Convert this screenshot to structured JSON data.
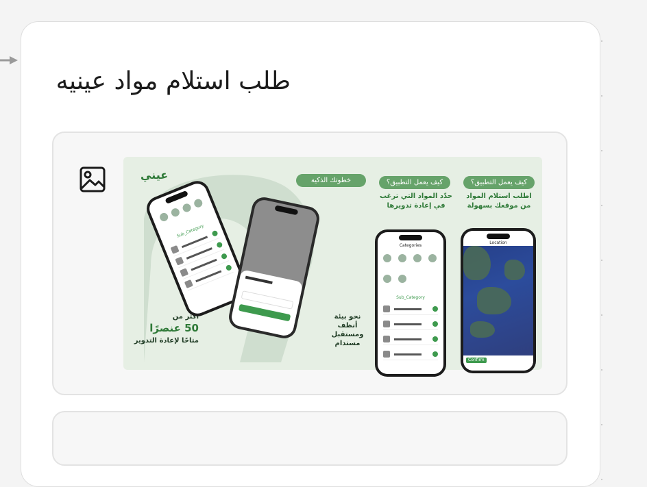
{
  "card": {
    "title": "طلب استلام مواد عينيه"
  },
  "image_block": {
    "icon": "image-icon"
  },
  "banner": {
    "brand": "عيني",
    "pill_steps": "خطوتك الذكية",
    "pill_how_1": "كيف يعمل التطبيق؟",
    "pill_how_2": "كيف يعمل التطبيق؟",
    "step_choose": "حدّد المواد التي ترغب في إعادة تدويرها",
    "step_request": "اطلب استلام المواد من موقعك بسهولة",
    "env_line": "نحو بيئة أنظف ومستقبل مستدام",
    "more_than": "أكثر من",
    "count": "50 عنصرًا",
    "available": "متاحًا لإعادة التدوير",
    "phone_sub_category": "Sub_Category",
    "phone_categories": "Categories",
    "phone_location": "Location",
    "phone_confirm": "Confirm"
  },
  "colors": {
    "banner_bg": "#e6efe4",
    "brand_green": "#2f7a38",
    "pill_green": "#66a36a"
  }
}
